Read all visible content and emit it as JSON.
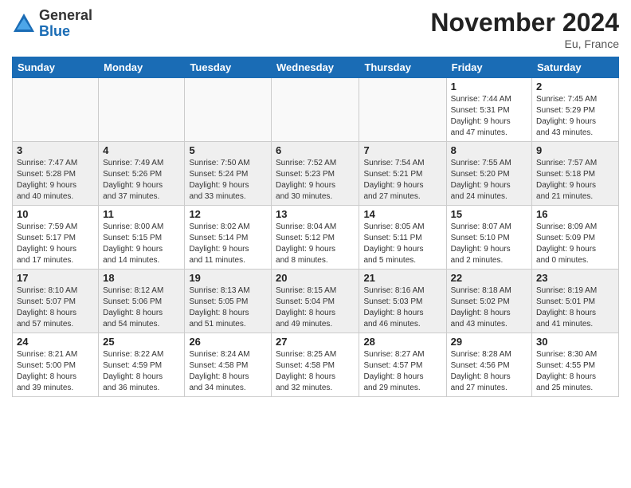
{
  "logo": {
    "general": "General",
    "blue": "Blue"
  },
  "title": "November 2024",
  "location": "Eu, France",
  "days_of_week": [
    "Sunday",
    "Monday",
    "Tuesday",
    "Wednesday",
    "Thursday",
    "Friday",
    "Saturday"
  ],
  "weeks": [
    {
      "shaded": false,
      "days": [
        {
          "num": "",
          "info": ""
        },
        {
          "num": "",
          "info": ""
        },
        {
          "num": "",
          "info": ""
        },
        {
          "num": "",
          "info": ""
        },
        {
          "num": "",
          "info": ""
        },
        {
          "num": "1",
          "info": "Sunrise: 7:44 AM\nSunset: 5:31 PM\nDaylight: 9 hours\nand 47 minutes."
        },
        {
          "num": "2",
          "info": "Sunrise: 7:45 AM\nSunset: 5:29 PM\nDaylight: 9 hours\nand 43 minutes."
        }
      ]
    },
    {
      "shaded": true,
      "days": [
        {
          "num": "3",
          "info": "Sunrise: 7:47 AM\nSunset: 5:28 PM\nDaylight: 9 hours\nand 40 minutes."
        },
        {
          "num": "4",
          "info": "Sunrise: 7:49 AM\nSunset: 5:26 PM\nDaylight: 9 hours\nand 37 minutes."
        },
        {
          "num": "5",
          "info": "Sunrise: 7:50 AM\nSunset: 5:24 PM\nDaylight: 9 hours\nand 33 minutes."
        },
        {
          "num": "6",
          "info": "Sunrise: 7:52 AM\nSunset: 5:23 PM\nDaylight: 9 hours\nand 30 minutes."
        },
        {
          "num": "7",
          "info": "Sunrise: 7:54 AM\nSunset: 5:21 PM\nDaylight: 9 hours\nand 27 minutes."
        },
        {
          "num": "8",
          "info": "Sunrise: 7:55 AM\nSunset: 5:20 PM\nDaylight: 9 hours\nand 24 minutes."
        },
        {
          "num": "9",
          "info": "Sunrise: 7:57 AM\nSunset: 5:18 PM\nDaylight: 9 hours\nand 21 minutes."
        }
      ]
    },
    {
      "shaded": false,
      "days": [
        {
          "num": "10",
          "info": "Sunrise: 7:59 AM\nSunset: 5:17 PM\nDaylight: 9 hours\nand 17 minutes."
        },
        {
          "num": "11",
          "info": "Sunrise: 8:00 AM\nSunset: 5:15 PM\nDaylight: 9 hours\nand 14 minutes."
        },
        {
          "num": "12",
          "info": "Sunrise: 8:02 AM\nSunset: 5:14 PM\nDaylight: 9 hours\nand 11 minutes."
        },
        {
          "num": "13",
          "info": "Sunrise: 8:04 AM\nSunset: 5:12 PM\nDaylight: 9 hours\nand 8 minutes."
        },
        {
          "num": "14",
          "info": "Sunrise: 8:05 AM\nSunset: 5:11 PM\nDaylight: 9 hours\nand 5 minutes."
        },
        {
          "num": "15",
          "info": "Sunrise: 8:07 AM\nSunset: 5:10 PM\nDaylight: 9 hours\nand 2 minutes."
        },
        {
          "num": "16",
          "info": "Sunrise: 8:09 AM\nSunset: 5:09 PM\nDaylight: 9 hours\nand 0 minutes."
        }
      ]
    },
    {
      "shaded": true,
      "days": [
        {
          "num": "17",
          "info": "Sunrise: 8:10 AM\nSunset: 5:07 PM\nDaylight: 8 hours\nand 57 minutes."
        },
        {
          "num": "18",
          "info": "Sunrise: 8:12 AM\nSunset: 5:06 PM\nDaylight: 8 hours\nand 54 minutes."
        },
        {
          "num": "19",
          "info": "Sunrise: 8:13 AM\nSunset: 5:05 PM\nDaylight: 8 hours\nand 51 minutes."
        },
        {
          "num": "20",
          "info": "Sunrise: 8:15 AM\nSunset: 5:04 PM\nDaylight: 8 hours\nand 49 minutes."
        },
        {
          "num": "21",
          "info": "Sunrise: 8:16 AM\nSunset: 5:03 PM\nDaylight: 8 hours\nand 46 minutes."
        },
        {
          "num": "22",
          "info": "Sunrise: 8:18 AM\nSunset: 5:02 PM\nDaylight: 8 hours\nand 43 minutes."
        },
        {
          "num": "23",
          "info": "Sunrise: 8:19 AM\nSunset: 5:01 PM\nDaylight: 8 hours\nand 41 minutes."
        }
      ]
    },
    {
      "shaded": false,
      "days": [
        {
          "num": "24",
          "info": "Sunrise: 8:21 AM\nSunset: 5:00 PM\nDaylight: 8 hours\nand 39 minutes."
        },
        {
          "num": "25",
          "info": "Sunrise: 8:22 AM\nSunset: 4:59 PM\nDaylight: 8 hours\nand 36 minutes."
        },
        {
          "num": "26",
          "info": "Sunrise: 8:24 AM\nSunset: 4:58 PM\nDaylight: 8 hours\nand 34 minutes."
        },
        {
          "num": "27",
          "info": "Sunrise: 8:25 AM\nSunset: 4:58 PM\nDaylight: 8 hours\nand 32 minutes."
        },
        {
          "num": "28",
          "info": "Sunrise: 8:27 AM\nSunset: 4:57 PM\nDaylight: 8 hours\nand 29 minutes."
        },
        {
          "num": "29",
          "info": "Sunrise: 8:28 AM\nSunset: 4:56 PM\nDaylight: 8 hours\nand 27 minutes."
        },
        {
          "num": "30",
          "info": "Sunrise: 8:30 AM\nSunset: 4:55 PM\nDaylight: 8 hours\nand 25 minutes."
        }
      ]
    }
  ]
}
